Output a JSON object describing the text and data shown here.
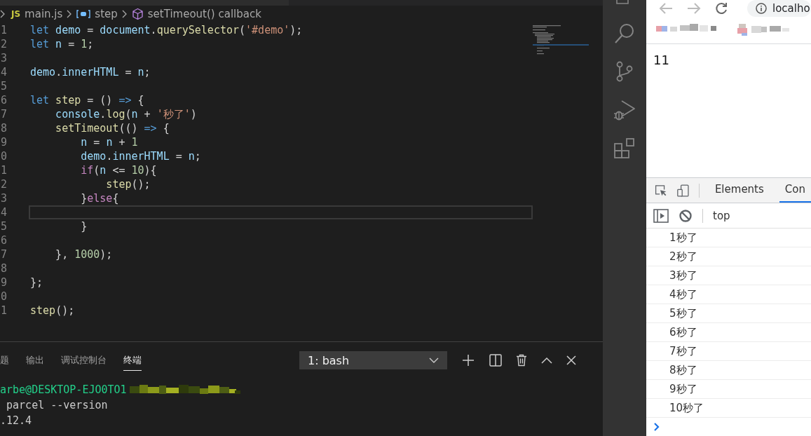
{
  "editor": {
    "breadcrumb": [
      {
        "kind": "file",
        "badge": "JS",
        "label": "main.js"
      },
      {
        "kind": "variable",
        "label": "step"
      },
      {
        "kind": "method",
        "label": "setTimeout() callback"
      }
    ],
    "lines": [
      {
        "number": "1",
        "current": false,
        "tokens": [
          {
            "kind": "kw",
            "text": "let"
          },
          {
            "kind": "var",
            "text": " demo"
          },
          {
            "kind": "p",
            "text": " = "
          },
          {
            "kind": "var",
            "text": "document"
          },
          {
            "kind": "p",
            "text": "."
          },
          {
            "kind": "fn",
            "text": "querySelector"
          },
          {
            "kind": "p",
            "text": "("
          },
          {
            "kind": "str",
            "text": "'#demo'"
          },
          {
            "kind": "p",
            "text": ");"
          }
        ]
      },
      {
        "number": "2",
        "current": false,
        "tokens": [
          {
            "kind": "kw",
            "text": "let"
          },
          {
            "kind": "var",
            "text": " n"
          },
          {
            "kind": "p",
            "text": " = "
          },
          {
            "kind": "num",
            "text": "1"
          },
          {
            "kind": "p",
            "text": ";"
          }
        ]
      },
      {
        "number": "3",
        "current": false
      },
      {
        "number": "4",
        "current": false,
        "tokens": [
          {
            "kind": "var",
            "text": "demo"
          },
          {
            "kind": "p",
            "text": "."
          },
          {
            "kind": "var",
            "text": "innerHTML"
          },
          {
            "kind": "p",
            "text": " = "
          },
          {
            "kind": "var",
            "text": "n"
          },
          {
            "kind": "p",
            "text": ";"
          }
        ]
      },
      {
        "number": "5",
        "current": false
      },
      {
        "number": "6",
        "current": false,
        "tokens": [
          {
            "kind": "kw",
            "text": "let"
          },
          {
            "kind": "fn",
            "text": " step"
          },
          {
            "kind": "p",
            "text": " = () "
          },
          {
            "kind": "kw",
            "text": "=>"
          },
          {
            "kind": "p",
            "text": " {"
          }
        ]
      },
      {
        "number": "7",
        "current": false,
        "tokens": [
          {
            "kind": "var",
            "text": "    console"
          },
          {
            "kind": "p",
            "text": "."
          },
          {
            "kind": "fn",
            "text": "log"
          },
          {
            "kind": "p",
            "text": "("
          },
          {
            "kind": "var",
            "text": "n"
          },
          {
            "kind": "p",
            "text": " + "
          },
          {
            "kind": "str",
            "text": "'秒了'"
          },
          {
            "kind": "p",
            "text": ")"
          }
        ]
      },
      {
        "number": "8",
        "current": false,
        "tokens": [
          {
            "kind": "fn",
            "text": "    setTimeout"
          },
          {
            "kind": "p",
            "text": "(() "
          },
          {
            "kind": "kw",
            "text": "=>"
          },
          {
            "kind": "p",
            "text": " {"
          }
        ]
      },
      {
        "number": "9",
        "current": false,
        "tokens": [
          {
            "kind": "var",
            "text": "        n"
          },
          {
            "kind": "p",
            "text": " = "
          },
          {
            "kind": "var",
            "text": "n"
          },
          {
            "kind": "p",
            "text": " + "
          },
          {
            "kind": "num",
            "text": "1"
          }
        ]
      },
      {
        "number": "0",
        "current": false,
        "tokens": [
          {
            "kind": "var",
            "text": "        demo"
          },
          {
            "kind": "p",
            "text": "."
          },
          {
            "kind": "var",
            "text": "innerHTML"
          },
          {
            "kind": "p",
            "text": " = "
          },
          {
            "kind": "var",
            "text": "n"
          },
          {
            "kind": "p",
            "text": ";"
          }
        ]
      },
      {
        "number": "1",
        "current": false,
        "tokens": [
          {
            "kind": "ctl",
            "text": "        if"
          },
          {
            "kind": "p",
            "text": "("
          },
          {
            "kind": "var",
            "text": "n"
          },
          {
            "kind": "p",
            "text": " <= "
          },
          {
            "kind": "num",
            "text": "10"
          },
          {
            "kind": "p",
            "text": "){"
          }
        ]
      },
      {
        "number": "2",
        "current": false,
        "tokens": [
          {
            "kind": "fn",
            "text": "            step"
          },
          {
            "kind": "p",
            "text": "();"
          }
        ]
      },
      {
        "number": "3",
        "current": false,
        "tokens": [
          {
            "kind": "p",
            "text": "        }"
          },
          {
            "kind": "ctl",
            "text": "else"
          },
          {
            "kind": "p",
            "text": "{"
          }
        ]
      },
      {
        "number": "4",
        "current": true
      },
      {
        "number": "5",
        "current": false,
        "tokens": [
          {
            "kind": "p",
            "text": "        }"
          }
        ]
      },
      {
        "number": "6",
        "current": false
      },
      {
        "number": "7",
        "current": false,
        "tokens": [
          {
            "kind": "p",
            "text": "    }, "
          },
          {
            "kind": "num",
            "text": "1000"
          },
          {
            "kind": "p",
            "text": ");"
          }
        ]
      },
      {
        "number": "8",
        "current": false
      },
      {
        "number": "9",
        "current": false,
        "tokens": [
          {
            "kind": "p",
            "text": "};"
          }
        ]
      },
      {
        "number": "0",
        "current": false
      },
      {
        "number": "1",
        "current": false,
        "tokens": [
          {
            "kind": "fn",
            "text": "step"
          },
          {
            "kind": "p",
            "text": "();"
          }
        ]
      }
    ]
  },
  "panel": {
    "tabs": [
      {
        "label": "题",
        "selected": false
      },
      {
        "label": "输出",
        "selected": false
      },
      {
        "label": "调试控制台",
        "selected": false
      },
      {
        "label": "终端",
        "selected": true
      }
    ],
    "terminal_select": "1: bash",
    "terminal_lines": [
      {
        "kind": "prompt",
        "text": "arbe@DESKTOP-EJO0TO1"
      },
      {
        "kind": "command",
        "text": " parcel --version"
      },
      {
        "kind": "output",
        "text": ".12.4"
      }
    ]
  },
  "browser": {
    "address": "localho",
    "page_text": "11",
    "devtools_tabs": [
      {
        "label": "Elements",
        "selected": false
      },
      {
        "label": "Con",
        "selected": true
      }
    ],
    "context": "top",
    "console_messages": [
      "1秒了",
      "2秒了",
      "3秒了",
      "4秒了",
      "5秒了",
      "6秒了",
      "7秒了",
      "8秒了",
      "9秒了",
      "10秒了"
    ]
  }
}
